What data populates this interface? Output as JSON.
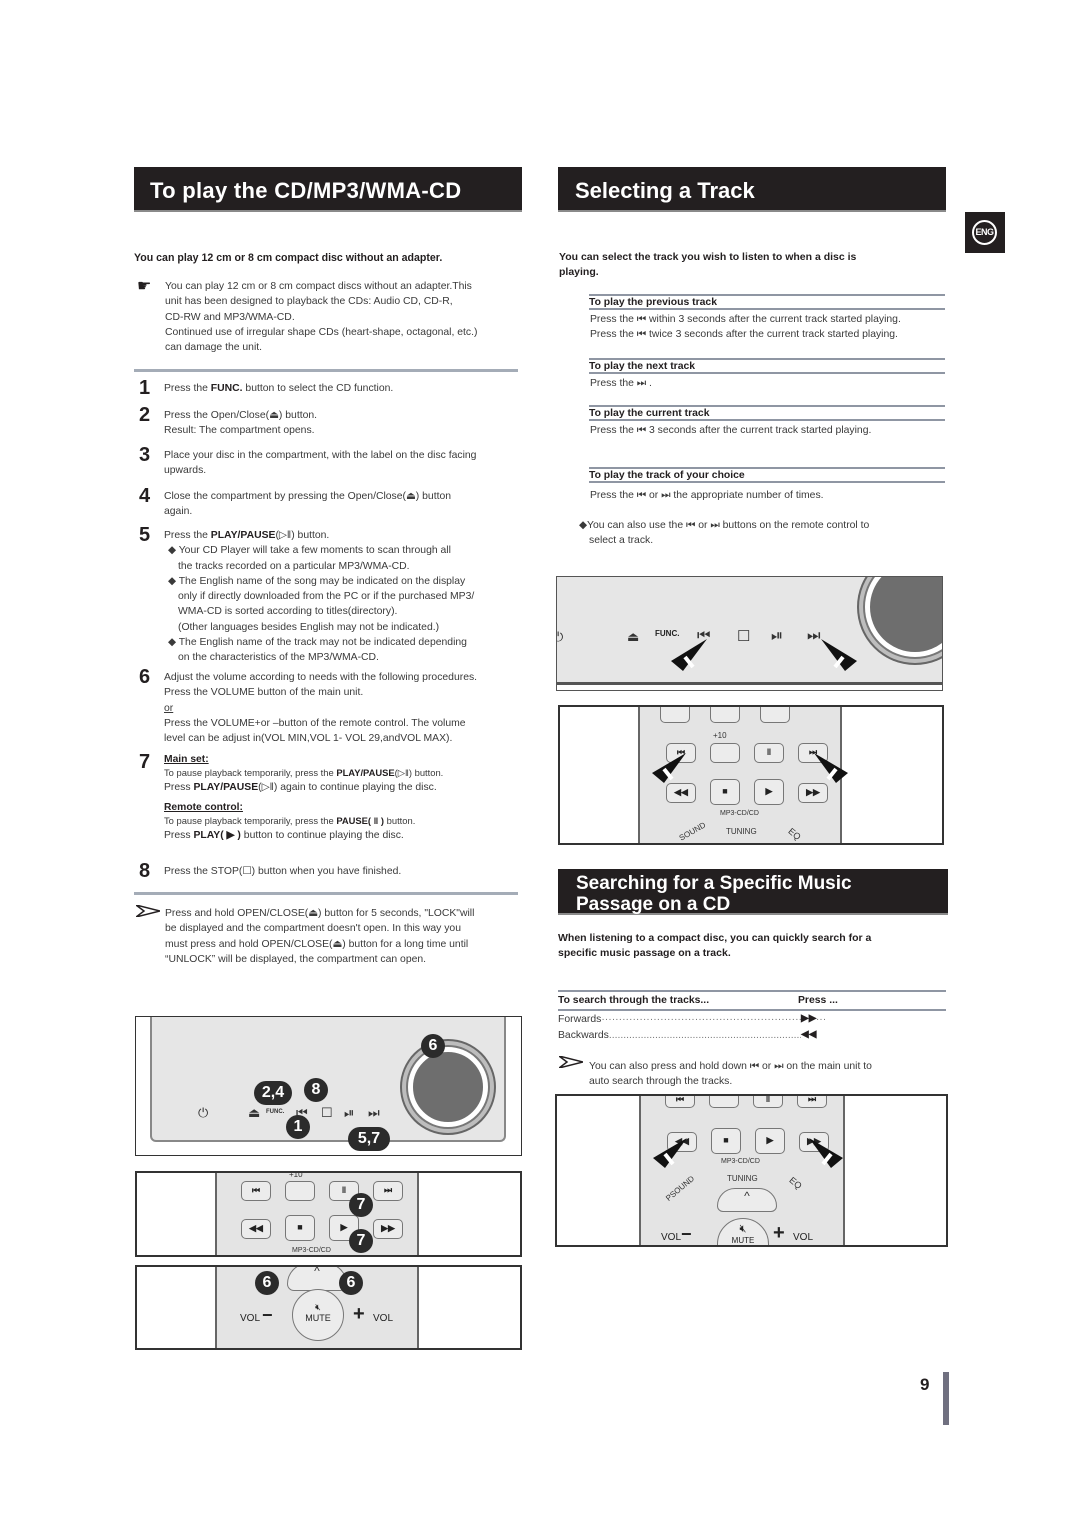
{
  "left": {
    "title": "To play the CD/MP3/WMA-CD",
    "intro": "You can play 12 cm or 8 cm compact disc without an adapter.",
    "note_icon": "pointing-hand-icon",
    "note_lines": [
      "You can play 12 cm or 8 cm compact discs without an adapter.This",
      "unit has been designed to playback the CDs: Audio CD, CD-R,",
      "CD-RW and MP3/WMA-CD.",
      "Continued use of irregular shape CDs (heart-shape, octagonal, etc.)",
      "can damage the unit."
    ],
    "steps": [
      {
        "num": "1",
        "pre": "Press the ",
        "bold": "FUNC.",
        "post": " button to select the CD function."
      },
      {
        "num": "2",
        "line1": "Press the Open/Close(⏏) button.",
        "line2": "Result: The compartment opens."
      },
      {
        "num": "3",
        "line1": "Place your disc in the compartment, with the label on the disc facing",
        "line2": "upwards."
      },
      {
        "num": "4",
        "line1": "Close the compartment by pressing the Open/Close(⏏) button",
        "line2": "again."
      },
      {
        "num": "5",
        "pre": "Press the ",
        "bold": "PLAY/PAUSE",
        "post": "(▷‖) button.",
        "bullets": [
          [
            "Your CD Player will take a few moments to scan through all",
            "the tracks recorded on a particular MP3/WMA-CD."
          ],
          [
            "The English name of the song may be indicated on the display",
            "only if directly downloaded from the PC or if the purchased MP3/",
            "WMA-CD is sorted according to titles(directory).",
            "(Other languages besides English may not be indicated.)"
          ],
          [
            "The English name of the track may not be indicated depending",
            "on the characteristics of the MP3/WMA-CD."
          ]
        ]
      },
      {
        "num": "6",
        "line1": "Adjust the volume according to needs with the following procedures.",
        "line2": "Press the VOLUME button of the main unit.",
        "or": "or",
        "line3": "Press the VOLUME+or –button of the remote control. The volume",
        "line4": "level can be adjust in(VOL MIN,VOL 1- VOL 29,andVOL MAX)."
      },
      {
        "num": "7",
        "main_label": "Main set:",
        "main_line1_pre": "To pause playback temporarily, press the ",
        "main_line1_bold": "PLAY/PAUSE",
        "main_line1_post": "(▷‖) button.",
        "main_line2_pre": "Press ",
        "main_line2_bold": "PLAY/PAUSE",
        "main_line2_post": "(▷‖) again to continue playing the disc.",
        "remote_label": "Remote control:",
        "remote_line1_pre": "To pause playback temporarily, press the ",
        "remote_line1_bold": "PAUSE( ‖ )",
        "remote_line1_post": " button.",
        "remote_line2_pre": "Press ",
        "remote_line2_bold": "PLAY( ▶ )",
        "remote_line2_post": " button to continue playing the disc."
      },
      {
        "num": "8",
        "line1": "Press the STOP(☐) button when you have finished."
      }
    ],
    "tip_icon": "arrow-tip-icon",
    "tip_lines": [
      "Press and hold OPEN/CLOSE(⏏) button for 5 seconds, \"LOCK\"will",
      "be displayed and the compartment doesn't open. In this way you",
      "must press and hold OPEN/CLOSE(⏏) button for a long time until",
      "“UNLOCK” will be displayed, the compartment can open."
    ],
    "unit_callouts": {
      "eject": "2,4",
      "func": "1",
      "stop": "8",
      "play": "5,7",
      "knob": "6"
    },
    "unit_func_label": "FUNC.",
    "remote1": {
      "plus10": "+10",
      "pause_callout": "7",
      "play_callout": "7",
      "group_label": "MP3-CD/CD"
    },
    "remote2": {
      "vol_label": "VOL",
      "mute_label": "MUTE",
      "minus_callout": "6",
      "plus_callout": "6"
    }
  },
  "right": {
    "title": "Selecting a Track",
    "lang_badge": "ENG",
    "intro_lines": [
      "You can select the track you wish to listen to when a disc is",
      "playing."
    ],
    "sections": [
      {
        "head": "To play the previous track",
        "lines": [
          "Press the ⏮ within 3 seconds after the current track started playing.",
          "Press the ⏮ twice 3 seconds after the current track started playing."
        ]
      },
      {
        "head": "To play the next track",
        "lines": [
          "Press the ⏭ ."
        ]
      },
      {
        "head": "To play the current track",
        "lines": [
          "Press the ⏮ 3 seconds after the current track started playing."
        ]
      },
      {
        "head": "To play the track of your choice",
        "lines": [
          "Press the ⏮ or ⏭   the appropriate number of times."
        ]
      }
    ],
    "remote_note_lines": [
      "You can also use the ⏮ or ⏭ buttons on the remote control to",
      "select a track."
    ],
    "unit_labels": {
      "func": "FUNC."
    },
    "remote": {
      "plus10": "+10",
      "group_label": "MP3-CD/CD",
      "sound": "SOUND",
      "tuning": "TUNING",
      "eq": "EQ"
    },
    "search": {
      "title_line1": "Searching for a Specific Music",
      "title_line2": "Passage on a CD",
      "intro_lines": [
        "When listening to a compact disc, you can quickly search for a",
        "specific music passage on a track."
      ],
      "table_head": [
        "To search through the tracks...",
        "Press ..."
      ],
      "rows": [
        {
          "label": "Forwards",
          "symbol": "▶▶"
        },
        {
          "label": "Backwards",
          "symbol": "◀◀"
        }
      ],
      "tip_lines": [
        "You can also press and hold down ⏮ or ⏭  on the main unit to",
        "auto  search through the tracks."
      ],
      "remote": {
        "group_label": "MP3-CD/CD",
        "psound": "PSOUND",
        "tuning": "TUNING",
        "eq": "EQ",
        "vol": "VOL",
        "mute": "MUTE"
      }
    }
  },
  "page_number": "9"
}
